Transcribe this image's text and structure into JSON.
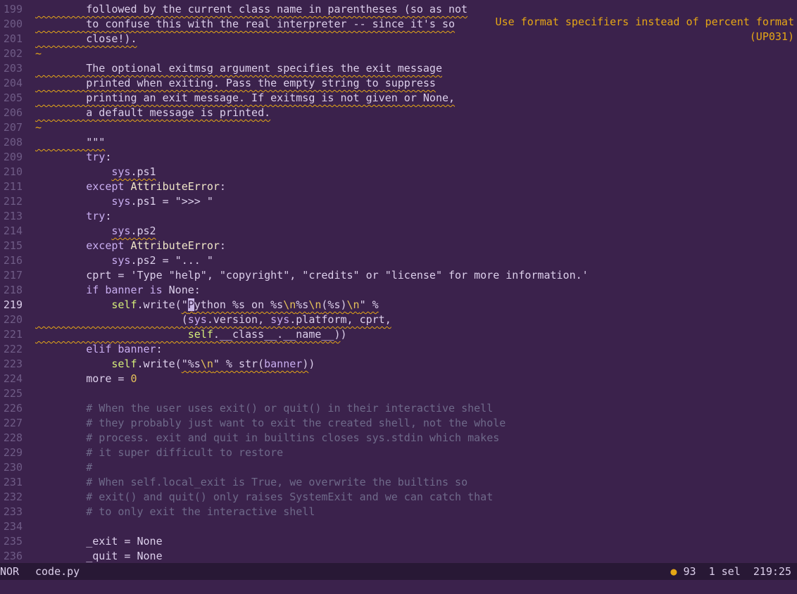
{
  "diagnostic": {
    "line1": "Use format specifiers instead of percent format",
    "line2": "(UP031)"
  },
  "status": {
    "mode": "NOR",
    "filename": "code.py",
    "diagnostics_count": "93",
    "selections": "1 sel",
    "position": "219:25"
  },
  "lines": [
    {
      "n": "199",
      "html": "<span class='squig'>        followed by the current class name in parentheses (so as not</span>"
    },
    {
      "n": "200",
      "html": "<span class='squig'>        to confuse this with the real interpreter -- since it's so</span>"
    },
    {
      "n": "201",
      "html": "<span class='squig'>        close!).</span>"
    },
    {
      "n": "202",
      "html": "<span class='tilde'>~</span>"
    },
    {
      "n": "203",
      "html": "<span class='squig'>        The optional exitmsg argument specifies the exit message</span>"
    },
    {
      "n": "204",
      "html": "<span class='squig'>        printed when exiting. Pass the empty string to suppress</span>"
    },
    {
      "n": "205",
      "html": "<span class='squig'>        printing an exit message. If exitmsg is not given or None,</span>"
    },
    {
      "n": "206",
      "html": "<span class='squig'>        a default message is printed.</span>"
    },
    {
      "n": "207",
      "html": "<span class='tilde'>~</span>"
    },
    {
      "n": "208",
      "html": "<span class='squig'>        \"\"\"</span>"
    },
    {
      "n": "209",
      "html": "        <span class='kw'>try</span>:"
    },
    {
      "n": "210",
      "html": "            <span class='squig'><span class='mod'>sys</span>.ps1</span>"
    },
    {
      "n": "211",
      "html": "        <span class='kw'>except</span> <span class='cls'>AttributeError</span>:"
    },
    {
      "n": "212",
      "html": "            <span class='mod'>sys</span>.ps1 = \">>> \""
    },
    {
      "n": "213",
      "html": "        <span class='kw'>try</span>:"
    },
    {
      "n": "214",
      "html": "            <span class='squig'><span class='mod'>sys</span>.ps2</span>"
    },
    {
      "n": "215",
      "html": "        <span class='kw'>except</span> <span class='cls'>AttributeError</span>:"
    },
    {
      "n": "216",
      "html": "            <span class='mod'>sys</span>.ps2 = \"... \""
    },
    {
      "n": "217",
      "html": "        cprt = 'Type \"help\", \"copyright\", \"credits\" or \"license\" for more information.'"
    },
    {
      "n": "218",
      "html": "        <span class='kw'>if</span> <span class='kw'>banner</span> <span class='kw'>is</span> None:"
    },
    {
      "n": "219",
      "html": "            <span class='self'>self</span>.write(<span class='squig'>\"<span class='cursor'>P</span>ython %s on %s<span class='esc'>\\n</span>%s<span class='esc'>\\n</span>(%s)<span class='esc'>\\n</span>\" %</span>"
    },
    {
      "n": "220",
      "html": "<span class='squig'>                       (<span class='mod'>sys</span>.version, <span class='mod'>sys</span>.platform, cprt,</span>"
    },
    {
      "n": "221",
      "html": "<span class='squig'>                        <span class='self'>self</span>.__class__.__name__)</span>)"
    },
    {
      "n": "222",
      "html": "        <span class='kw'>elif</span> <span class='kw'>banner</span>:"
    },
    {
      "n": "223",
      "html": "            <span class='self'>self</span>.write(<span class='squig'>\"%s<span class='esc'>\\n</span>\" % str(<span class='kw'>banner</span>)</span>)"
    },
    {
      "n": "224",
      "html": "        more = <span class='num'>0</span>"
    },
    {
      "n": "225",
      "html": ""
    },
    {
      "n": "226",
      "html": "        <span class='cmt'># When the user uses exit() or quit() in their interactive shell</span>"
    },
    {
      "n": "227",
      "html": "        <span class='cmt'># they probably just want to exit the created shell, not the whole</span>"
    },
    {
      "n": "228",
      "html": "        <span class='cmt'># process. exit and quit in builtins closes sys.stdin which makes</span>"
    },
    {
      "n": "229",
      "html": "        <span class='cmt'># it super difficult to restore</span>"
    },
    {
      "n": "230",
      "html": "        <span class='cmt'>#</span>"
    },
    {
      "n": "231",
      "html": "        <span class='cmt'># When self.local_exit is True, we overwrite the builtins so</span>"
    },
    {
      "n": "232",
      "html": "        <span class='cmt'># exit() and quit() only raises SystemExit and we can catch that</span>"
    },
    {
      "n": "233",
      "html": "        <span class='cmt'># to only exit the interactive shell</span>"
    },
    {
      "n": "234",
      "html": ""
    },
    {
      "n": "235",
      "html": "        _exit = None"
    },
    {
      "n": "236",
      "html": "        _quit = None"
    }
  ],
  "current_line": "219",
  "colors": {
    "background": "#3b224c",
    "statusbar": "#281835",
    "warning": "#e6a716"
  }
}
